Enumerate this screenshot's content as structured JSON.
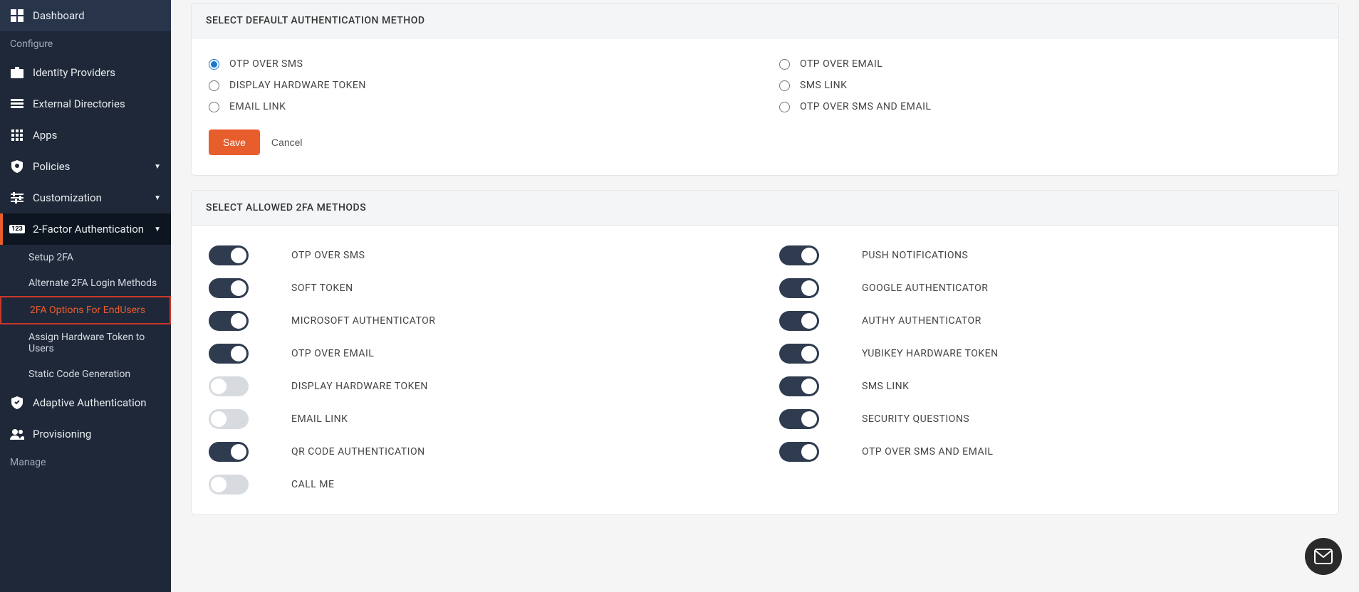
{
  "sidebar": {
    "dashboard": "Dashboard",
    "configure_label": "Configure",
    "identity_providers": "Identity Providers",
    "external_directories": "External Directories",
    "apps": "Apps",
    "policies": "Policies",
    "customization": "Customization",
    "two_factor": "2-Factor Authentication",
    "subs": {
      "setup_2fa": "Setup 2FA",
      "alternate": "Alternate 2FA Login Methods",
      "options_eu": "2FA Options For EndUsers",
      "assign_hw": "Assign Hardware Token to Users",
      "static_code": "Static Code Generation"
    },
    "adaptive": "Adaptive Authentication",
    "provisioning": "Provisioning",
    "manage_label": "Manage"
  },
  "panel1": {
    "title": "SELECT DEFAULT AUTHENTICATION METHOD",
    "radios": {
      "otp_sms": "OTP OVER SMS",
      "otp_email": "OTP OVER EMAIL",
      "display_hw": "DISPLAY HARDWARE TOKEN",
      "sms_link": "SMS LINK",
      "email_link": "EMAIL LINK",
      "otp_sms_email": "OTP OVER SMS AND EMAIL"
    },
    "save": "Save",
    "cancel": "Cancel"
  },
  "panel2": {
    "title": "SELECT ALLOWED 2FA METHODS",
    "left": [
      {
        "label": "OTP OVER SMS",
        "on": true
      },
      {
        "label": "SOFT TOKEN",
        "on": true
      },
      {
        "label": "MICROSOFT AUTHENTICATOR",
        "on": true
      },
      {
        "label": "OTP OVER EMAIL",
        "on": true
      },
      {
        "label": "DISPLAY HARDWARE TOKEN",
        "on": false
      },
      {
        "label": "EMAIL LINK",
        "on": false
      },
      {
        "label": "QR CODE AUTHENTICATION",
        "on": true
      },
      {
        "label": "CALL ME",
        "on": false
      }
    ],
    "right": [
      {
        "label": "PUSH NOTIFICATIONS",
        "on": true
      },
      {
        "label": "GOOGLE AUTHENTICATOR",
        "on": true
      },
      {
        "label": "AUTHY AUTHENTICATOR",
        "on": true
      },
      {
        "label": "YUBIKEY HARDWARE TOKEN",
        "on": true
      },
      {
        "label": "SMS LINK",
        "on": true
      },
      {
        "label": "SECURITY QUESTIONS",
        "on": true
      },
      {
        "label": "OTP OVER SMS AND EMAIL",
        "on": true
      }
    ]
  }
}
